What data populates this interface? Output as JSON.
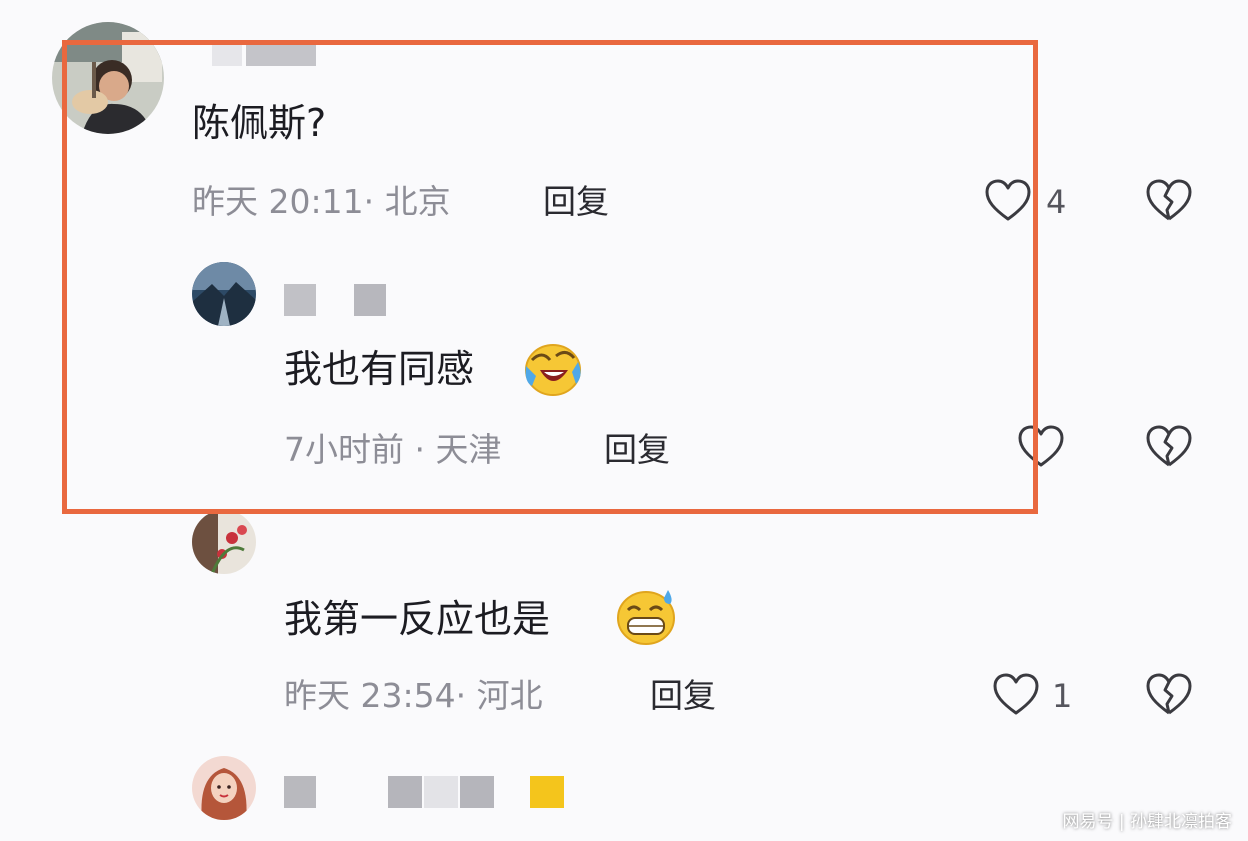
{
  "comments": [
    {
      "text": "陈佩斯?",
      "meta": "昨天 20:11· 北京",
      "reply_label": "回复",
      "like_count": "4"
    },
    {
      "text": "我也有同感",
      "emoji": "crying-laughing-emoji",
      "meta": "7小时前 · 天津",
      "reply_label": "回复",
      "like_count": ""
    },
    {
      "text": "我第一反应也是",
      "emoji": "sweat-grin-emoji",
      "meta": "昨天 23:54· 河北",
      "reply_label": "回复",
      "like_count": "1"
    }
  ],
  "icons": {
    "like": "heart-icon",
    "dislike": "broken-heart-icon"
  },
  "colors": {
    "highlight_border": "#e9683f",
    "meta_text": "#8d8d96",
    "censor_block": "#bdbdc2"
  },
  "watermark": "网易号 | 孙肆北凛拍客"
}
